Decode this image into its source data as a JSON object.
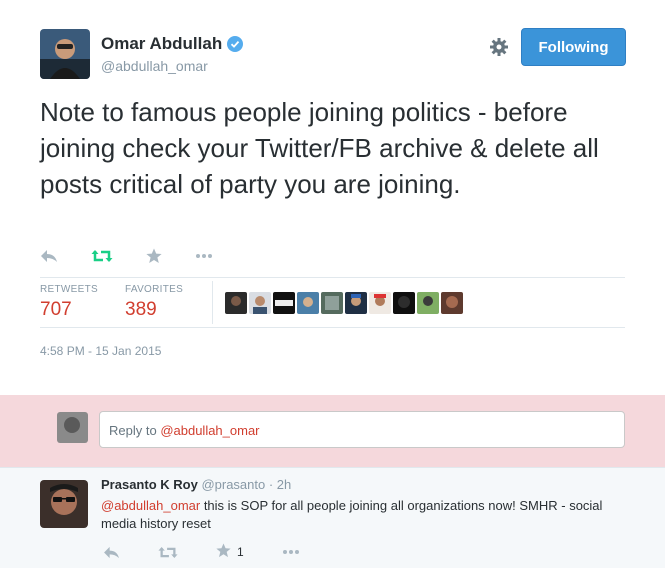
{
  "tweet": {
    "author_name": "Omar Abdullah",
    "author_handle": "@abdullah_omar",
    "follow_label": "Following",
    "text": "Note to famous people joining politics - before joining check your Twitter/FB archive & delete all posts critical of party you are joining.",
    "retweets_label": "RETWEETS",
    "retweets_count": "707",
    "favorites_label": "FAVORITES",
    "favorites_count": "389",
    "timestamp": "4:58 PM - 15 Jan 2015",
    "actions": [
      "reply-icon",
      "retweet-icon",
      "favorite-icon",
      "more-icon"
    ],
    "retweet_icon_color": "#19cf86",
    "verified_color": "#55acee"
  },
  "reply_box": {
    "prefix": "Reply to ",
    "mention": "@abdullah_omar"
  },
  "reply": {
    "name": "Prasanto K Roy",
    "handle": "@prasanto",
    "time": " · 2h",
    "mention": "@abdullah_omar",
    "text": " this is SOP for all people joining all organizations now! SMHR - social media history reset",
    "favorite_count": "1",
    "actions": [
      "reply-icon",
      "retweet-icon",
      "favorite-icon",
      "more-icon"
    ]
  },
  "colors": {
    "accent": "#3b94d9",
    "stat_red": "#d13e2f",
    "reply_bg": "#f5d8dc",
    "reply_tweet_bg": "#f5f8fa"
  }
}
